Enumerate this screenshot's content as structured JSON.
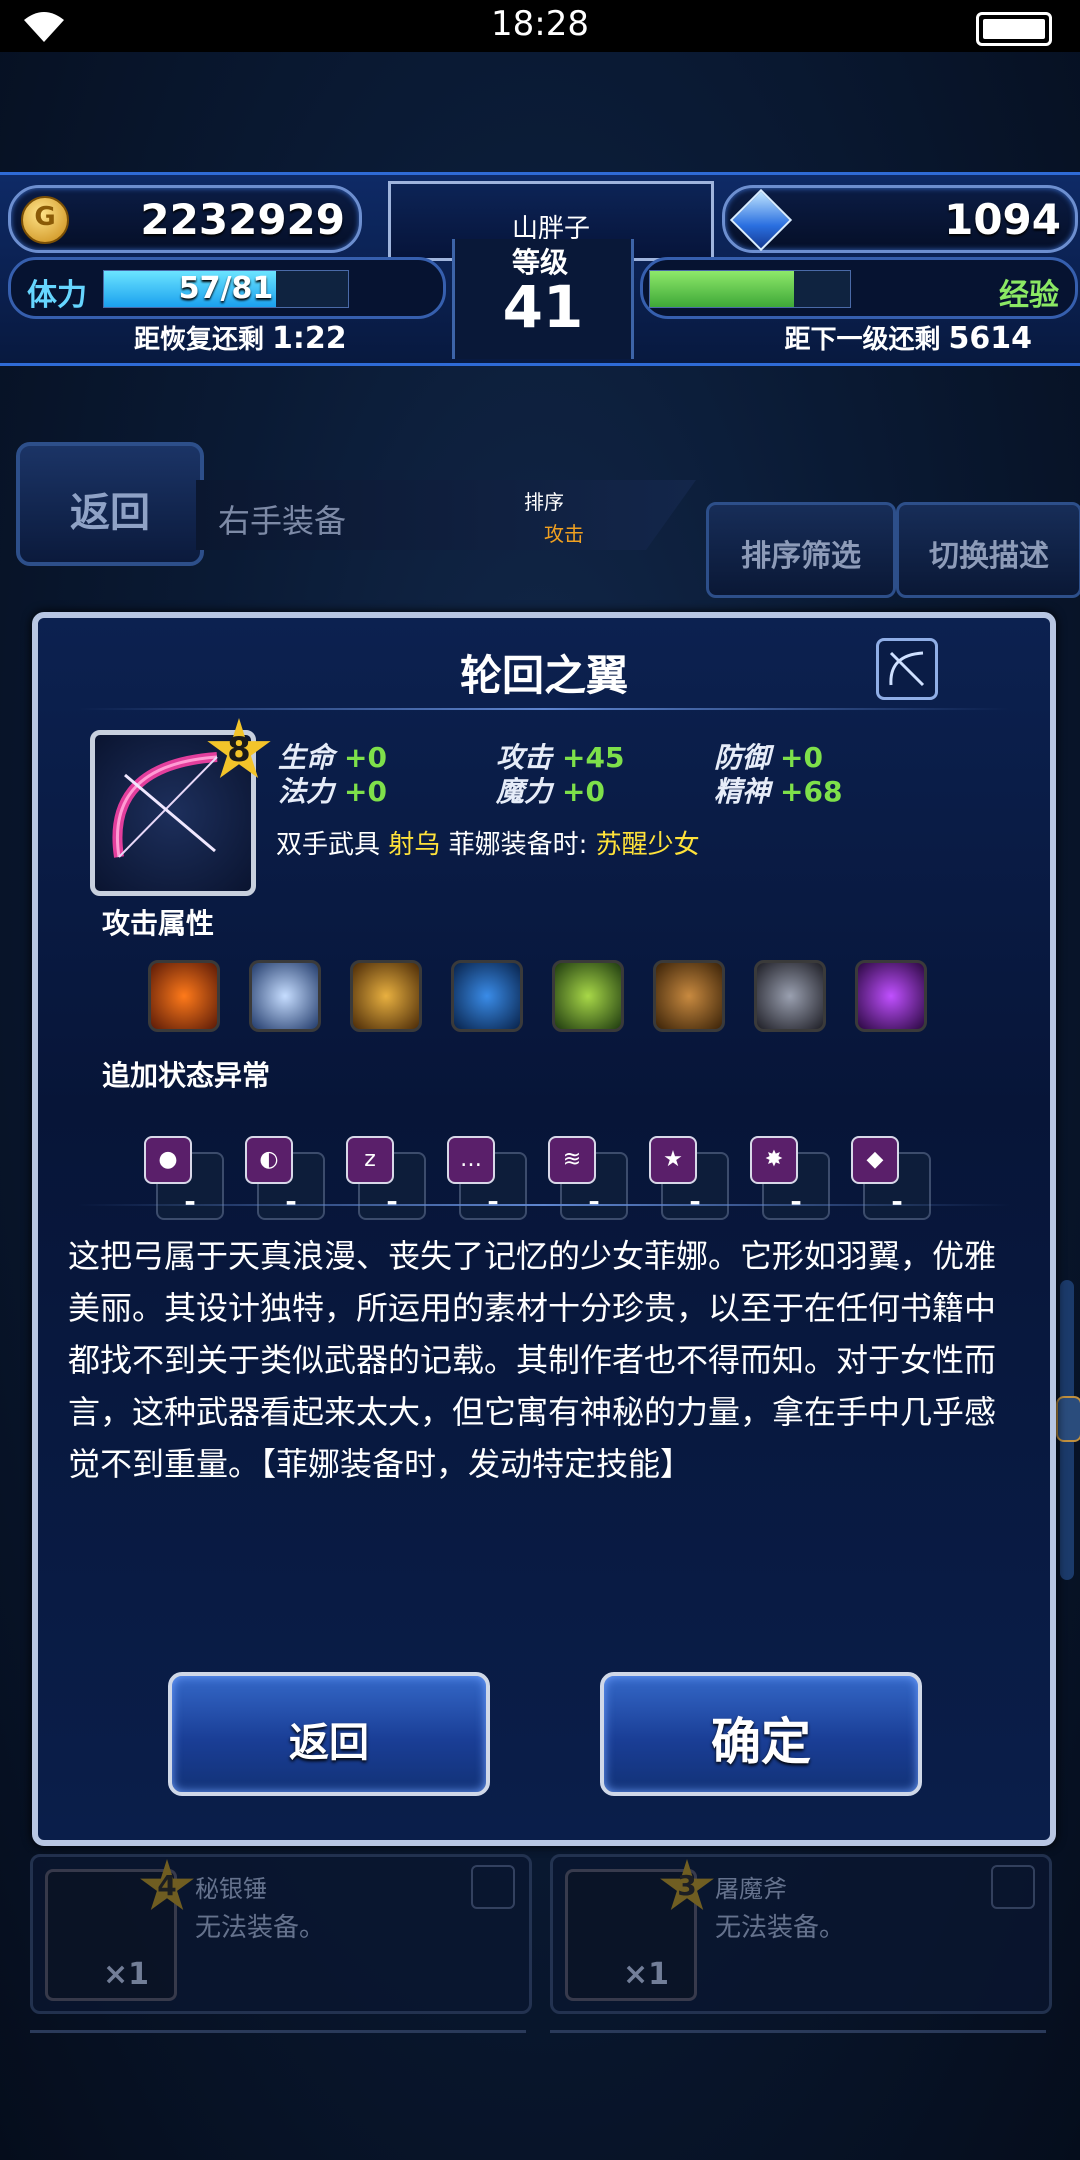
{
  "status_bar": {
    "time": "18:28"
  },
  "hud": {
    "gil": "2232929",
    "gems": "1094",
    "player_name": "山胖子",
    "level_label": "等级",
    "level": "41",
    "stamina_label": "体力",
    "stamina": "57/81",
    "stamina_fraction": 0.704,
    "recover_label": "距恢复还剩",
    "recover_time": "1:22",
    "exp_label": "经验",
    "exp_fraction": 0.72,
    "next_level_label": "距下一级还剩",
    "next_level_value": "5614"
  },
  "nav": {
    "back": "返回",
    "equip_slot": "右手装备",
    "sort_label": "排序",
    "sort_value": "攻击",
    "filter_button": "排序筛选",
    "switch_button": "切换描述"
  },
  "dialog": {
    "title": "轮回之翼",
    "rarity": "8",
    "stats": [
      {
        "label": "生命",
        "value": "+0"
      },
      {
        "label": "攻击",
        "value": "+45"
      },
      {
        "label": "防御",
        "value": "+0"
      },
      {
        "label": "法力",
        "value": "+0"
      },
      {
        "label": "魔力",
        "value": "+0"
      },
      {
        "label": "精神",
        "value": "+68"
      }
    ],
    "weapon_type": "双手武具",
    "weapon_class": "射乌",
    "equip_condition": "菲娜装备时:",
    "equip_bonus": "苏醒少女",
    "attack_attr_label": "攻击属性",
    "status_label": "追加状态异常",
    "status_values": [
      "-",
      "-",
      "-",
      "-",
      "-",
      "-",
      "-",
      "-"
    ],
    "description": "这把弓属于天真浪漫、丧失了记忆的少女菲娜。它形如羽翼，优雅美丽。其设计独特，所运用的素材十分珍贵，以至于在任何书籍中都找不到关于类似武器的记载。其制作者也不得而知。对于女性而言，这种武器看起来太大，但它寓有神秘的力量，拿在手中几乎感觉不到重量。【菲娜装备时，发动特定技能】",
    "back_button": "返回",
    "confirm_button": "确定"
  },
  "items": [
    {
      "rarity": "4",
      "name": "秘银锤",
      "note": "无法装备。",
      "qty": "×1"
    },
    {
      "rarity": "3",
      "name": "屠魔斧",
      "note": "无法装备。",
      "qty": "×1"
    }
  ]
}
